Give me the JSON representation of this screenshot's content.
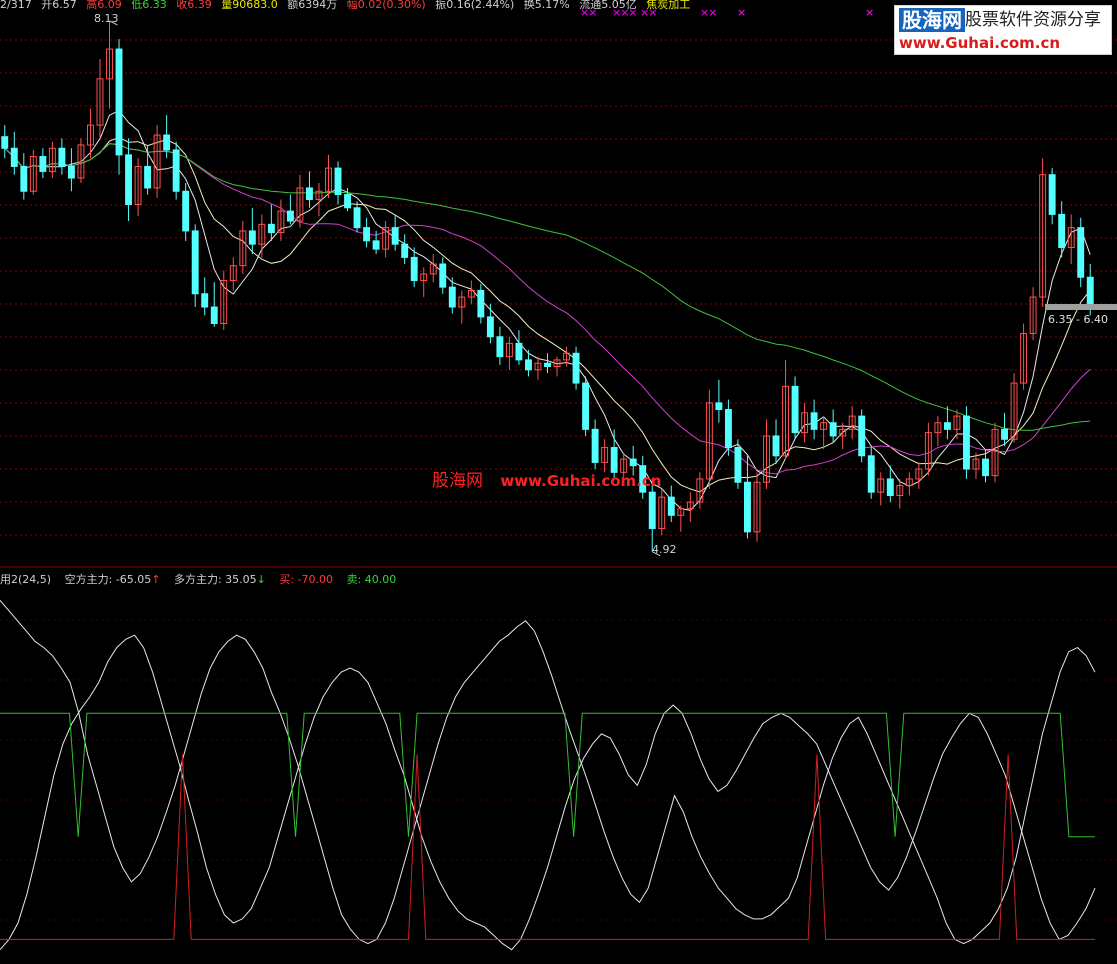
{
  "info_bar": {
    "date": "2/317",
    "open": "开6.57",
    "high": "高6.09",
    "low": "低6.33",
    "close": "收6.39",
    "volume": "量90683.0",
    "amount": "额6394万",
    "change": "幅0.02(0.30%)",
    "amplitude": "振0.16(2.44%)",
    "turnover": "换5.17%",
    "float_shares": "流通5.05亿",
    "suffix": "焦炭加工"
  },
  "markers": [
    "××",
    "×××",
    "××",
    "××",
    "×",
    "×"
  ],
  "logo": {
    "brand": "股海网",
    "slogan": "股票软件资源分享",
    "url": "www.Guhai.com.cn"
  },
  "watermark": {
    "brand": "股海网",
    "url": "www.Guhai.com.cn"
  },
  "price_tags": {
    "high": "8.13",
    "low": "4.92",
    "last": "6.35 - 6.40"
  },
  "indicator": {
    "name": "用2(24,5)",
    "bear_label": "空方主力: -65.05",
    "bear_arrow": "↑",
    "bull_label": "多方主力: 35.05",
    "bull_arrow": "↓",
    "buy_label": "买: -70.00",
    "sell_label": "卖: 40.00"
  },
  "colors": {
    "up": "#ff5050",
    "down": "#54ffff",
    "ma_short": "#e8e8e8",
    "ma_mid": "#d040d0",
    "ma_long": "#40c040",
    "grid": "#8a0000",
    "buy_line": "#d02020",
    "sell_line": "#30c030"
  },
  "chart_data": [
    {
      "type": "candlestick",
      "y_range": [
        4.92,
        8.13
      ],
      "annotations": [
        "8.13",
        "4.92",
        "6.35 - 6.40"
      ],
      "candles": [
        [
          7.43,
          7.5,
          7.3,
          7.36
        ],
        [
          7.36,
          7.46,
          7.2,
          7.25
        ],
        [
          7.25,
          7.33,
          7.05,
          7.1
        ],
        [
          7.1,
          7.35,
          7.08,
          7.31
        ],
        [
          7.31,
          7.36,
          7.18,
          7.22
        ],
        [
          7.22,
          7.4,
          7.18,
          7.36
        ],
        [
          7.36,
          7.42,
          7.2,
          7.25
        ],
        [
          7.25,
          7.36,
          7.1,
          7.18
        ],
        [
          7.18,
          7.42,
          7.15,
          7.38
        ],
        [
          7.38,
          7.6,
          7.3,
          7.5
        ],
        [
          7.5,
          7.9,
          7.42,
          7.78
        ],
        [
          7.78,
          8.13,
          7.6,
          7.96
        ],
        [
          7.96,
          8.02,
          7.2,
          7.32
        ],
        [
          7.32,
          7.42,
          6.92,
          7.02
        ],
        [
          7.02,
          7.3,
          6.95,
          7.25
        ],
        [
          7.25,
          7.38,
          7.08,
          7.12
        ],
        [
          7.12,
          7.5,
          7.06,
          7.44
        ],
        [
          7.44,
          7.56,
          7.3,
          7.35
        ],
        [
          7.35,
          7.4,
          7.05,
          7.1
        ],
        [
          7.1,
          7.15,
          6.8,
          6.86
        ],
        [
          6.86,
          6.9,
          6.4,
          6.48
        ],
        [
          6.48,
          6.58,
          6.35,
          6.4
        ],
        [
          6.4,
          6.55,
          6.28,
          6.3
        ],
        [
          6.3,
          6.62,
          6.26,
          6.56
        ],
        [
          6.56,
          6.7,
          6.5,
          6.65
        ],
        [
          6.65,
          6.92,
          6.6,
          6.86
        ],
        [
          6.86,
          7.0,
          6.72,
          6.78
        ],
        [
          6.78,
          6.96,
          6.7,
          6.9
        ],
        [
          6.9,
          7.02,
          6.8,
          6.85
        ],
        [
          6.85,
          7.05,
          6.8,
          6.98
        ],
        [
          6.98,
          7.08,
          6.9,
          6.92
        ],
        [
          6.92,
          7.2,
          6.88,
          7.12
        ],
        [
          7.12,
          7.22,
          7.0,
          7.05
        ],
        [
          7.05,
          7.15,
          6.95,
          7.1
        ],
        [
          7.1,
          7.32,
          7.06,
          7.24
        ],
        [
          7.24,
          7.28,
          7.02,
          7.08
        ],
        [
          7.08,
          7.12,
          6.98,
          7.0
        ],
        [
          7.0,
          7.04,
          6.85,
          6.88
        ],
        [
          6.88,
          6.94,
          6.76,
          6.8
        ],
        [
          6.8,
          6.86,
          6.72,
          6.75
        ],
        [
          6.75,
          6.92,
          6.7,
          6.88
        ],
        [
          6.88,
          6.96,
          6.74,
          6.78
        ],
        [
          6.78,
          6.84,
          6.66,
          6.7
        ],
        [
          6.7,
          6.76,
          6.52,
          6.56
        ],
        [
          6.56,
          6.64,
          6.46,
          6.6
        ],
        [
          6.6,
          6.72,
          6.55,
          6.66
        ],
        [
          6.66,
          6.7,
          6.48,
          6.52
        ],
        [
          6.52,
          6.58,
          6.36,
          6.4
        ],
        [
          6.4,
          6.5,
          6.3,
          6.46
        ],
        [
          6.46,
          6.56,
          6.42,
          6.5
        ],
        [
          6.5,
          6.54,
          6.3,
          6.34
        ],
        [
          6.34,
          6.42,
          6.18,
          6.22
        ],
        [
          6.22,
          6.28,
          6.05,
          6.1
        ],
        [
          6.1,
          6.22,
          6.02,
          6.18
        ],
        [
          6.18,
          6.26,
          6.05,
          6.08
        ],
        [
          6.08,
          6.14,
          5.98,
          6.02
        ],
        [
          6.02,
          6.1,
          5.96,
          6.06
        ],
        [
          6.06,
          6.12,
          6.0,
          6.04
        ],
        [
          6.04,
          6.1,
          5.98,
          6.08
        ],
        [
          6.08,
          6.16,
          6.04,
          6.12
        ],
        [
          6.12,
          6.16,
          5.9,
          5.94
        ],
        [
          5.94,
          5.98,
          5.62,
          5.66
        ],
        [
          5.66,
          5.72,
          5.42,
          5.46
        ],
        [
          5.46,
          5.6,
          5.4,
          5.55
        ],
        [
          5.55,
          5.66,
          5.36,
          5.4
        ],
        [
          5.4,
          5.52,
          5.32,
          5.48
        ],
        [
          5.48,
          5.56,
          5.38,
          5.44
        ],
        [
          5.44,
          5.5,
          5.24,
          5.28
        ],
        [
          5.28,
          5.36,
          4.92,
          5.06
        ],
        [
          5.06,
          5.3,
          5.02,
          5.25
        ],
        [
          5.25,
          5.32,
          5.1,
          5.14
        ],
        [
          5.14,
          5.2,
          5.04,
          5.18
        ],
        [
          5.18,
          5.28,
          5.1,
          5.22
        ],
        [
          5.22,
          5.4,
          5.18,
          5.36
        ],
        [
          5.36,
          5.9,
          5.3,
          5.82
        ],
        [
          5.82,
          5.96,
          5.7,
          5.78
        ],
        [
          5.78,
          5.84,
          5.5,
          5.55
        ],
        [
          5.55,
          5.6,
          5.3,
          5.34
        ],
        [
          5.34,
          5.5,
          5.0,
          5.04
        ],
        [
          5.04,
          5.4,
          4.98,
          5.34
        ],
        [
          5.34,
          5.72,
          5.3,
          5.62
        ],
        [
          5.62,
          5.72,
          5.45,
          5.5
        ],
        [
          5.5,
          6.08,
          5.48,
          5.92
        ],
        [
          5.92,
          5.98,
          5.6,
          5.64
        ],
        [
          5.64,
          5.82,
          5.58,
          5.76
        ],
        [
          5.76,
          5.84,
          5.6,
          5.66
        ],
        [
          5.66,
          5.74,
          5.54,
          5.7
        ],
        [
          5.7,
          5.78,
          5.58,
          5.62
        ],
        [
          5.62,
          5.7,
          5.54,
          5.66
        ],
        [
          5.66,
          5.8,
          5.6,
          5.74
        ],
        [
          5.74,
          5.78,
          5.46,
          5.5
        ],
        [
          5.5,
          5.56,
          5.24,
          5.28
        ],
        [
          5.28,
          5.4,
          5.2,
          5.36
        ],
        [
          5.36,
          5.44,
          5.22,
          5.26
        ],
        [
          5.26,
          5.36,
          5.18,
          5.32
        ],
        [
          5.32,
          5.4,
          5.26,
          5.36
        ],
        [
          5.36,
          5.46,
          5.3,
          5.42
        ],
        [
          5.42,
          5.7,
          5.38,
          5.64
        ],
        [
          5.64,
          5.74,
          5.56,
          5.7
        ],
        [
          5.7,
          5.8,
          5.6,
          5.66
        ],
        [
          5.66,
          5.78,
          5.6,
          5.74
        ],
        [
          5.74,
          5.8,
          5.36,
          5.42
        ],
        [
          5.42,
          5.52,
          5.36,
          5.48
        ],
        [
          5.48,
          5.54,
          5.34,
          5.38
        ],
        [
          5.38,
          5.7,
          5.34,
          5.66
        ],
        [
          5.66,
          5.76,
          5.56,
          5.6
        ],
        [
          5.6,
          6.0,
          5.58,
          5.94
        ],
        [
          5.94,
          6.3,
          5.9,
          6.24
        ],
        [
          6.24,
          6.52,
          6.2,
          6.46
        ],
        [
          6.46,
          7.3,
          6.4,
          7.2
        ],
        [
          7.2,
          7.24,
          6.9,
          6.96
        ],
        [
          6.96,
          7.04,
          6.7,
          6.76
        ],
        [
          6.76,
          6.96,
          6.66,
          6.88
        ],
        [
          6.88,
          6.94,
          6.52,
          6.58
        ],
        [
          6.58,
          6.66,
          6.35,
          6.4
        ]
      ]
    },
    {
      "type": "line",
      "series": [
        {
          "color": "#e8e8e8"
        },
        {
          "color": "#e8e8e8"
        },
        {
          "color": "#30c030"
        },
        {
          "color": "#d02020"
        }
      ],
      "values": [
        [
          95,
          90,
          85,
          80,
          75,
          72,
          68,
          62,
          55,
          40,
          20,
          5,
          -10,
          -25,
          -35,
          -42,
          -38,
          -30,
          -20,
          -8,
          5,
          20,
          35,
          50,
          62,
          70,
          75,
          78,
          76,
          70,
          62,
          50,
          40,
          28,
          15,
          0,
          -15,
          -30,
          -45,
          -58,
          -65,
          -70,
          -72,
          -70,
          -62,
          -50,
          -35,
          -20,
          -5,
          10,
          25,
          38,
          48,
          55,
          60,
          65,
          70,
          75,
          78,
          82,
          85,
          80,
          70,
          58,
          45,
          32,
          20,
          8,
          -5,
          -18,
          -30,
          -40,
          -48,
          -52,
          -45,
          -30,
          -15,
          0,
          -8,
          -20,
          -30,
          -38,
          -45,
          -50,
          -55,
          -58,
          -60,
          -60,
          -58,
          -54,
          -50,
          -40,
          -25,
          -10,
          5,
          18,
          28,
          35,
          38,
          30,
          20,
          10,
          0,
          -10,
          -20,
          -30,
          -40,
          -50,
          -62,
          -70,
          -72,
          -70,
          -66,
          -62,
          -55,
          -45,
          -30,
          -10,
          10,
          30,
          45,
          60,
          70,
          72,
          68,
          60
        ],
        [
          -75,
          -70,
          -62,
          -48,
          -30,
          -10,
          10,
          25,
          35,
          42,
          48,
          55,
          65,
          72,
          76,
          78,
          72,
          60,
          45,
          30,
          15,
          -2,
          -18,
          -35,
          -48,
          -58,
          -62,
          -60,
          -55,
          -45,
          -35,
          -20,
          -5,
          10,
          25,
          38,
          48,
          55,
          60,
          62,
          60,
          55,
          45,
          35,
          22,
          10,
          -5,
          -20,
          -32,
          -42,
          -50,
          -56,
          -60,
          -62,
          -64,
          -68,
          -72,
          -75,
          -70,
          -60,
          -48,
          -35,
          -20,
          -5,
          8,
          18,
          25,
          30,
          28,
          20,
          10,
          5,
          15,
          30,
          40,
          44,
          40,
          30,
          18,
          8,
          2,
          5,
          12,
          20,
          28,
          35,
          38,
          40,
          38,
          34,
          30,
          25,
          15,
          5,
          -5,
          -15,
          -25,
          -35,
          -42,
          -46,
          -40,
          -30,
          -18,
          -5,
          8,
          20,
          28,
          35,
          40,
          38,
          30,
          20,
          10,
          -5,
          -20,
          -35,
          -50,
          -62,
          -70,
          -68,
          -62,
          -55,
          -45
        ],
        [
          40,
          40,
          40,
          40,
          40,
          40,
          40,
          40,
          40,
          40,
          40,
          40,
          40,
          40,
          40,
          40,
          40,
          40,
          40,
          40,
          40,
          40,
          40,
          40,
          40,
          40,
          40,
          40,
          40,
          40,
          40,
          40,
          40,
          40,
          40,
          40,
          40,
          40,
          40,
          40,
          40,
          40,
          40,
          40,
          40,
          40,
          40,
          40,
          40,
          40,
          40,
          40,
          40,
          40,
          40,
          40,
          40,
          40,
          40,
          40,
          40,
          40,
          40,
          40,
          40,
          40,
          40,
          40,
          40,
          40,
          40,
          40,
          40,
          40,
          40,
          40,
          40,
          40,
          40,
          40,
          40,
          40,
          40,
          40,
          40,
          40,
          40,
          40,
          40,
          40,
          40,
          40,
          40,
          40,
          40,
          40,
          40,
          40,
          40,
          40,
          40,
          40,
          40,
          40,
          40,
          40,
          40,
          40,
          40,
          40,
          40,
          40,
          40,
          40,
          40,
          40,
          40,
          40,
          40,
          40,
          40,
          40,
          40,
          40,
          40,
          40,
          40
        ],
        [
          -70,
          -70,
          -70,
          -70,
          -70,
          -70,
          -70,
          -70,
          -70,
          -70,
          -70,
          -70,
          -70,
          -70,
          -70,
          -70,
          -70,
          -70,
          -70,
          -70,
          -70,
          -70,
          -70,
          -70,
          -70,
          -70,
          -70,
          -70,
          -70,
          -70,
          -70,
          -70,
          -70,
          -70,
          -70,
          -70,
          -70,
          -70,
          -70,
          -70,
          -70,
          -70,
          -70,
          -70,
          -70,
          -70,
          -70,
          -70,
          -70,
          -70,
          -70,
          -70,
          -70,
          -70,
          -70,
          -70,
          -70,
          -70,
          -70,
          -70,
          -70,
          -70,
          -70,
          -70,
          -70,
          -70,
          -70,
          -70,
          -70,
          -70,
          -70,
          -70,
          -70,
          -70,
          -70,
          -70,
          -70,
          -70,
          -70,
          -70,
          -70,
          -70,
          -70,
          -70,
          -70,
          -70,
          -70,
          -70,
          -70,
          -70,
          -70,
          -70,
          -70,
          -70,
          -70,
          -70,
          -70,
          -70,
          -70,
          -70,
          -70,
          -70,
          -70,
          -70,
          -70,
          -70,
          -70,
          -70,
          -70,
          -70,
          -70,
          -70,
          -70,
          -70,
          -70,
          -70,
          -70,
          -70,
          -70,
          -70,
          -70,
          -70,
          -70,
          -70,
          -70,
          -70,
          -70
        ]
      ],
      "y_range": [
        -80,
        100
      ]
    }
  ]
}
